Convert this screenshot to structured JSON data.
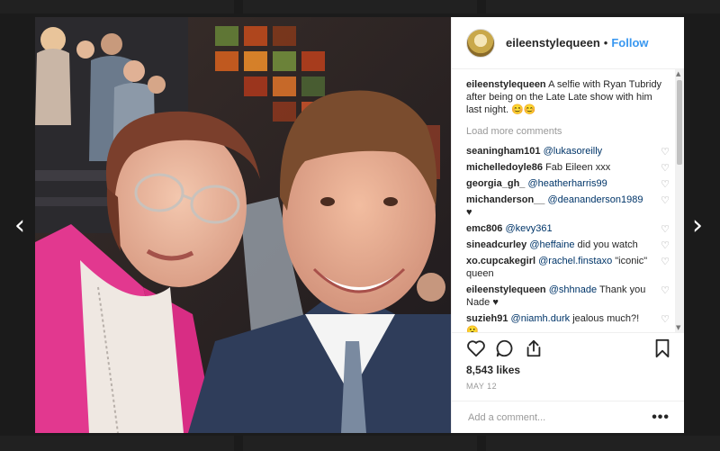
{
  "post": {
    "username": "eileenstylequeen",
    "separator": "•",
    "follow_label": "Follow",
    "caption": {
      "username": "eileenstylequeen",
      "text": "A selfie with Ryan Tubridy after being on the Late Late show with him last night. 😊😊"
    },
    "load_more_label": "Load more comments",
    "comments": [
      {
        "user": "seaningham101",
        "mention": "@lukasoreilly",
        "text": ""
      },
      {
        "user": "michelledoyle86",
        "mention": "",
        "text": "Fab Eileen xxx"
      },
      {
        "user": "georgia_gh_",
        "mention": "@heatherharris99",
        "text": ""
      },
      {
        "user": "michanderson__",
        "mention": "@deananderson1989",
        "text": "♥"
      },
      {
        "user": "emc806",
        "mention": "@kevy361",
        "text": ""
      },
      {
        "user": "sineadcurley",
        "mention": "@heffaine",
        "text": "did you watch"
      },
      {
        "user": "xo.cupcakegirl",
        "mention": "@rachel.finstaxo",
        "text": "\"iconic\" queen"
      },
      {
        "user": "eileenstylequeen",
        "mention": "@shhnade",
        "text": "Thank you Nade ♥"
      },
      {
        "user": "suzieh91",
        "mention": "@niamh.durk",
        "text": "jealous much?! 😮"
      }
    ],
    "likes": "8,543 likes",
    "date": "MAY 12",
    "add_comment_placeholder": "Add a comment...",
    "more_label": "•••"
  },
  "nav": {
    "prev": "‹",
    "next": "›"
  },
  "icons": {
    "heart": "heart-icon",
    "comment": "comment-icon",
    "share": "share-icon",
    "bookmark": "bookmark-icon"
  },
  "colors": {
    "link": "#3897f0",
    "mention": "#003569",
    "muted": "#999999"
  }
}
